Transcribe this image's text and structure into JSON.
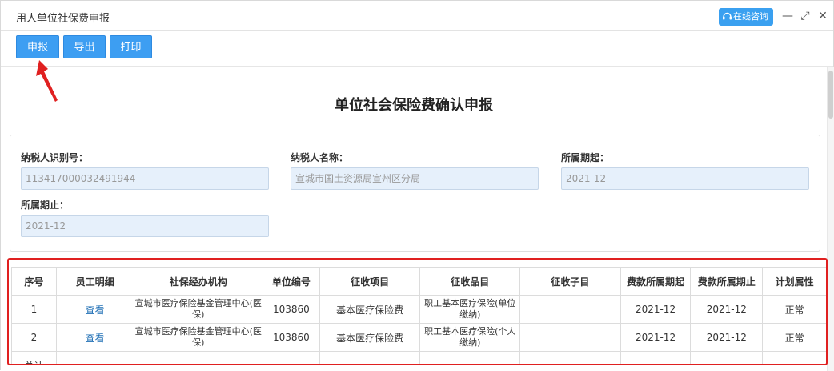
{
  "window": {
    "title": "用人单位社保费申报",
    "consult_label": "在线咨询",
    "minimize": "—",
    "restore": "⤢",
    "close": "✕"
  },
  "toolbar": {
    "declare": "申报",
    "export": "导出",
    "print": "打印"
  },
  "form": {
    "title": "单位社会保险费确认申报",
    "taxpayer_id_label": "纳税人识别号：",
    "taxpayer_id_value": "113417000032491944",
    "taxpayer_name_label": "纳税人名称：",
    "taxpayer_name_value": "宣城市国土资源局宣州区分局",
    "period_start_label": "所属期起：",
    "period_start_value": "2021-12",
    "period_end_label": "所属期止：",
    "period_end_value": "2021-12"
  },
  "table": {
    "headers": [
      "序号",
      "员工明细",
      "社保经办机构",
      "单位编号",
      "征收项目",
      "征收品目",
      "征收子目",
      "费款所属期起",
      "费款所属期止",
      "计划属性"
    ],
    "rows": [
      {
        "seq": "1",
        "detail": "查看",
        "agency": "宣城市医疗保险基金管理中心(医保)",
        "unit_no": "103860",
        "item": "基本医疗保险费",
        "sub_item": "职工基本医疗保险(单位缴纳)",
        "sub_sub": "",
        "start": "2021-12",
        "end": "2021-12",
        "attr": "正常"
      },
      {
        "seq": "2",
        "detail": "查看",
        "agency": "宣城市医疗保险基金管理中心(医保)",
        "unit_no": "103860",
        "item": "基本医疗保险费",
        "sub_item": "职工基本医疗保险(个人缴纳)",
        "sub_sub": "",
        "start": "2021-12",
        "end": "2021-12",
        "attr": "正常"
      }
    ],
    "total_label": "总计",
    "total_dash": "-"
  },
  "colors": {
    "accent": "#3d9ef2",
    "highlight_border": "#e02020",
    "input_bg": "#e6f0fb"
  },
  "icons": {
    "consult": "headset-icon",
    "annotation": "red-arrow-icon"
  }
}
